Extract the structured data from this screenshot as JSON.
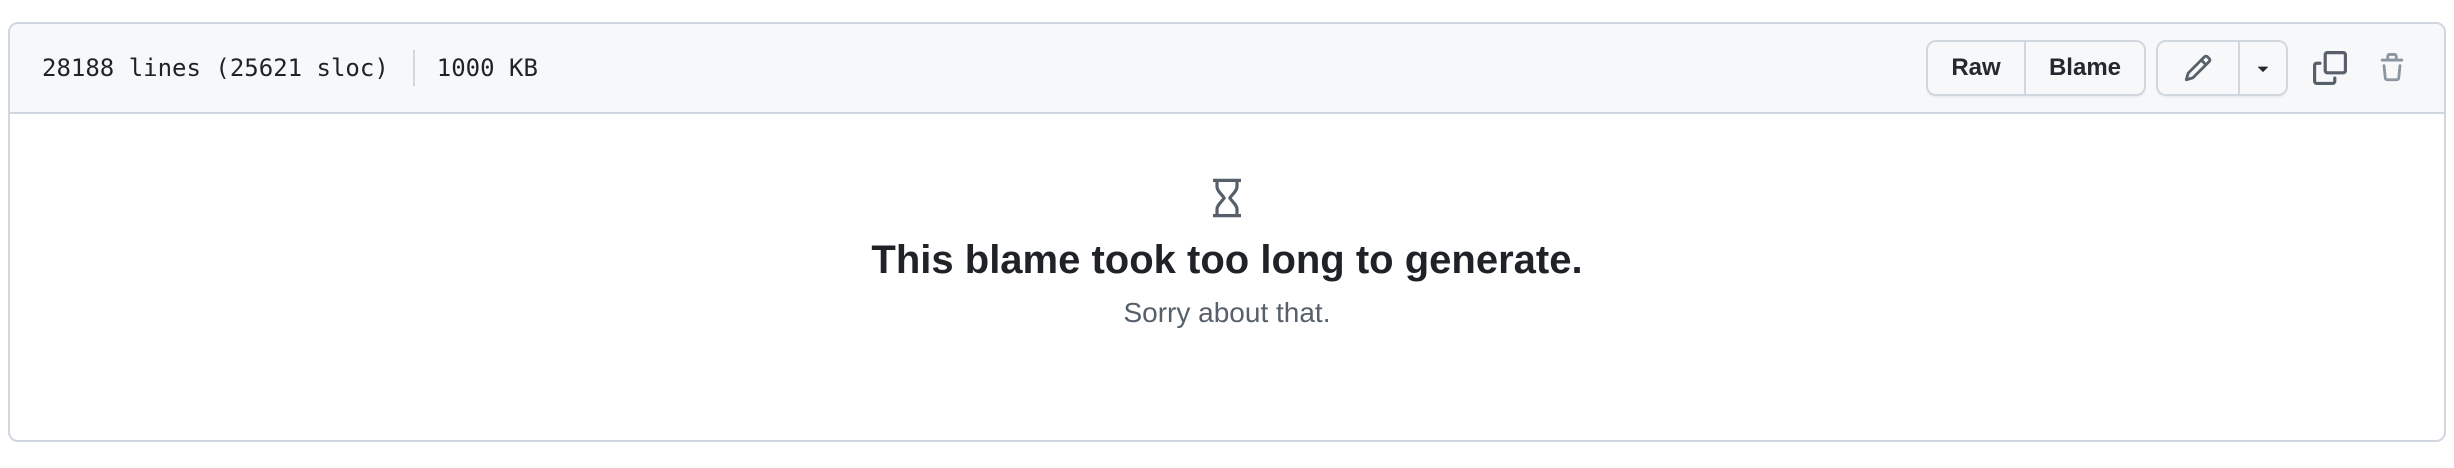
{
  "file_info": {
    "lines": "28188 lines (25621 sloc)",
    "size": "1000 KB"
  },
  "toolbar": {
    "raw_label": "Raw",
    "blame_label": "Blame"
  },
  "icons": {
    "edit": "pencil-icon",
    "more": "triangle-down-icon",
    "copy": "copy-icon",
    "delete": "trash-icon",
    "status": "hourglass-icon"
  },
  "message": {
    "title": "This blame took too long to generate.",
    "subtitle": "Sorry about that."
  },
  "colors": {
    "border": "#d0d7de",
    "header_bg": "#f6f8fa",
    "text": "#1f2328",
    "muted_text": "#57606a",
    "icon": "#57606a"
  }
}
